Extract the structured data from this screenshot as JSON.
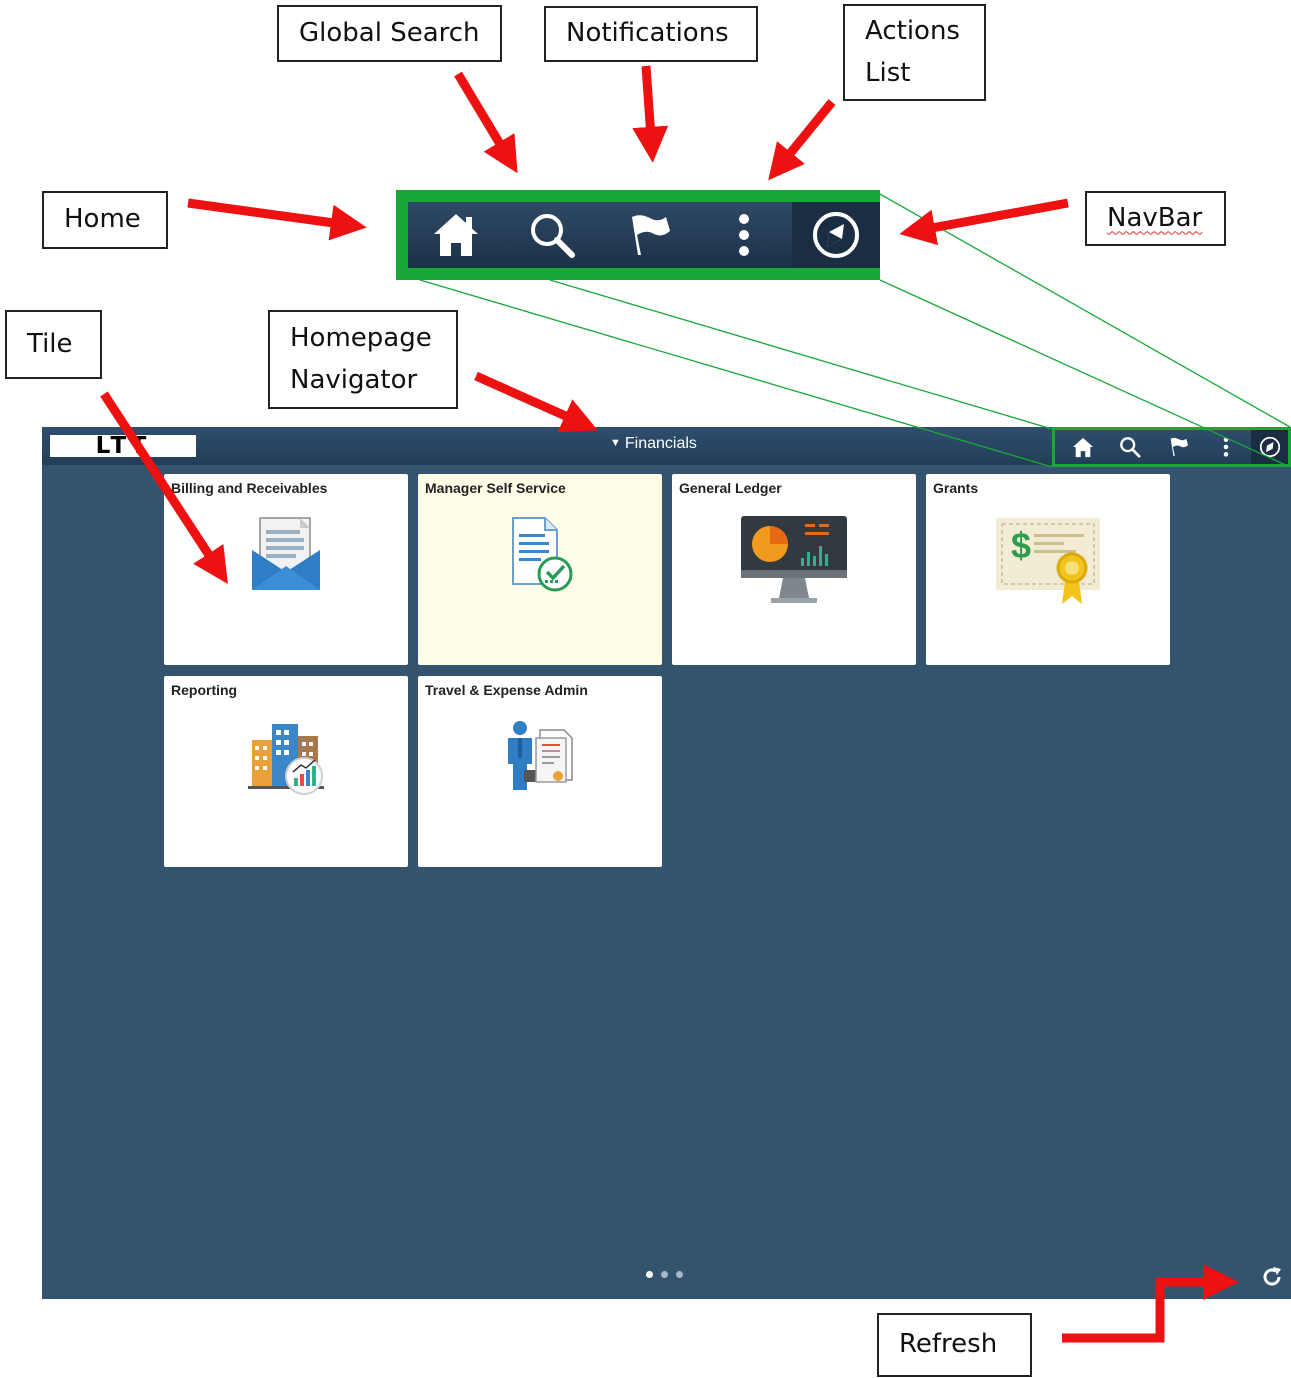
{
  "annotations": {
    "global_search": "Global Search",
    "notifications": "Notifications",
    "actions_list": [
      "Actions",
      "List"
    ],
    "home": "Home",
    "navbar": "NavBar",
    "tile": "Tile",
    "homepage_navigator": [
      "Homepage",
      "Navigator"
    ],
    "refresh": "Refresh"
  },
  "app": {
    "logo": "LTT",
    "homepage_navigator": "Financials",
    "navbar_icons": [
      "home-icon",
      "search-icon",
      "flag-icon",
      "more-vertical-icon",
      "compass-icon"
    ],
    "tiles": [
      {
        "title": "Billing and Receivables",
        "icon": "invoice-envelope-icon"
      },
      {
        "title": "Manager Self Service",
        "icon": "document-check-icon"
      },
      {
        "title": "General Ledger",
        "icon": "monitor-chart-icon"
      },
      {
        "title": "Grants",
        "icon": "certificate-icon"
      },
      {
        "title": "Reporting",
        "icon": "buildings-chart-icon"
      },
      {
        "title": "Travel & Expense Admin",
        "icon": "person-document-icon"
      }
    ],
    "page_dots": {
      "count": 3,
      "active": 1
    },
    "refresh_icon": "refresh-icon"
  },
  "colors": {
    "banner": "#2b4864",
    "panel": "#33536f",
    "highlight_green": "#19a838",
    "arrow_red": "#ee1111",
    "highlighted_tile": "#fefde8"
  }
}
